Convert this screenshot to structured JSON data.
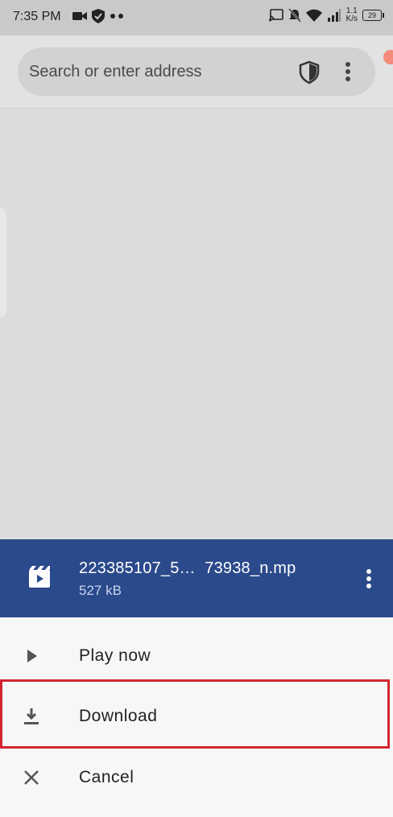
{
  "status_bar": {
    "time": "7:35 PM",
    "left_icons": [
      "video-camera-icon",
      "shield-check-icon",
      "more-dots-icon"
    ],
    "net_speed_top": "1.1",
    "net_speed_bottom": "K/s",
    "battery": "29",
    "right_icons": [
      "cast-icon",
      "bell-off-icon",
      "wifi-icon",
      "signal-icon"
    ]
  },
  "browser": {
    "address_placeholder": "Search or enter address",
    "icons": [
      "shield-icon",
      "overflow-menu-icon"
    ]
  },
  "download": {
    "file_name": "223385107_5…  73938_n.mp",
    "file_size": "527 kB",
    "icons": [
      "video-file-icon",
      "overflow-menu-icon"
    ],
    "header_color": "#2b4a8b"
  },
  "actions": [
    {
      "label": "Play now",
      "icon": "play-icon"
    },
    {
      "label": "Download",
      "icon": "download-icon",
      "highlighted": true
    },
    {
      "label": "Cancel",
      "icon": "close-icon"
    }
  ],
  "colors": {
    "highlight": "#d2262f"
  }
}
